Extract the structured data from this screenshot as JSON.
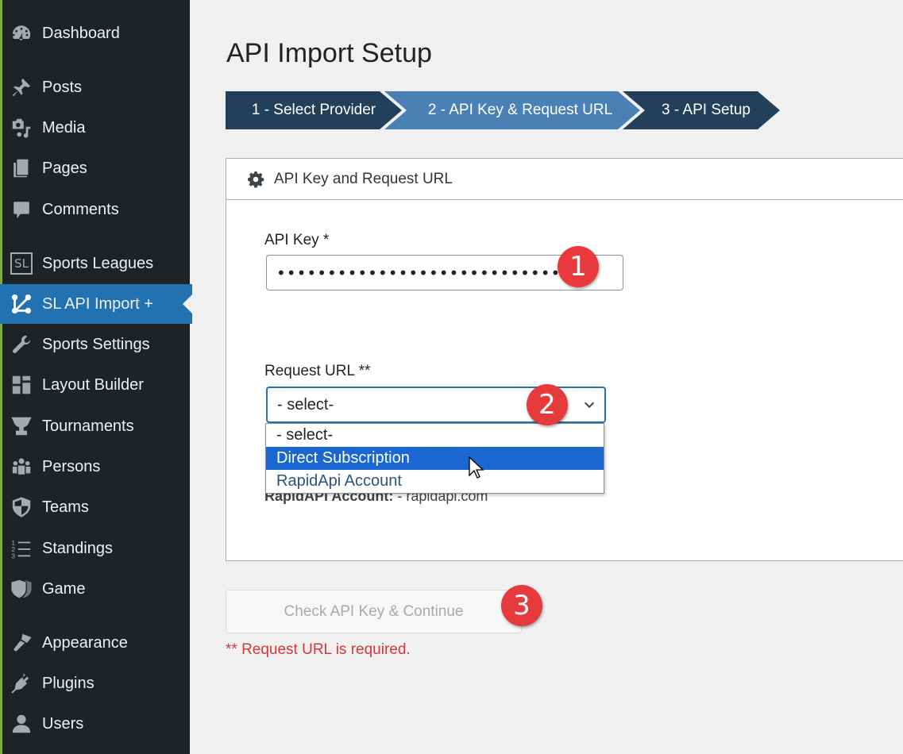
{
  "sidebar": {
    "items": [
      {
        "label": "Dashboard",
        "icon": "dashboard-icon"
      },
      {
        "label": "Posts",
        "icon": "pin-icon"
      },
      {
        "label": "Media",
        "icon": "media-icon"
      },
      {
        "label": "Pages",
        "icon": "pages-icon"
      },
      {
        "label": "Comments",
        "icon": "comment-icon"
      },
      {
        "label": "Sports Leagues",
        "icon": "sl-logo-icon",
        "icon_text": "SL"
      },
      {
        "label": "SL API Import +",
        "icon": "api-import-icon",
        "active": true
      },
      {
        "label": "Sports Settings",
        "icon": "wrench-icon"
      },
      {
        "label": "Layout Builder",
        "icon": "layout-icon"
      },
      {
        "label": "Tournaments",
        "icon": "trophy-icon"
      },
      {
        "label": "Persons",
        "icon": "persons-icon"
      },
      {
        "label": "Teams",
        "icon": "shield-icon"
      },
      {
        "label": "Standings",
        "icon": "ordered-list-icon"
      },
      {
        "label": "Game",
        "icon": "game-shield-icon"
      },
      {
        "label": "Appearance",
        "icon": "paintbrush-icon"
      },
      {
        "label": "Plugins",
        "icon": "plug-icon"
      },
      {
        "label": "Users",
        "icon": "user-icon"
      }
    ]
  },
  "page": {
    "title": "API Import Setup"
  },
  "steps": [
    {
      "label": "1 - Select Provider",
      "state": "done"
    },
    {
      "label": "2 - API Key & Request URL",
      "state": "current"
    },
    {
      "label": "3 - API Setup",
      "state": "upcoming"
    }
  ],
  "panel": {
    "title": "API Key and Request URL",
    "api_key": {
      "label": "API Key *",
      "value": "••••••••••••••••••••••••••••••"
    },
    "request_url": {
      "label": "Request URL **",
      "selected": "- select-",
      "options": [
        "- select-",
        "Direct Subscription",
        "RapidApi Account"
      ],
      "highlighted": "Direct Subscription"
    },
    "hidden_note": {
      "bold": "RapidAPI Account:",
      "text": " - rapidapi.com"
    }
  },
  "actions": {
    "continue_label": "Check API Key & Continue",
    "error": "** Request URL is required."
  },
  "annotations": [
    "1",
    "2",
    "3"
  ],
  "colors": {
    "sidebar_bg": "#1d2327",
    "active_item": "#2271b1",
    "step_dark": "#23405a",
    "step_current": "#4b80b4",
    "badge": "#e73a3c",
    "error": "#d63638",
    "dropdown_highlight": "#1a67d2"
  }
}
